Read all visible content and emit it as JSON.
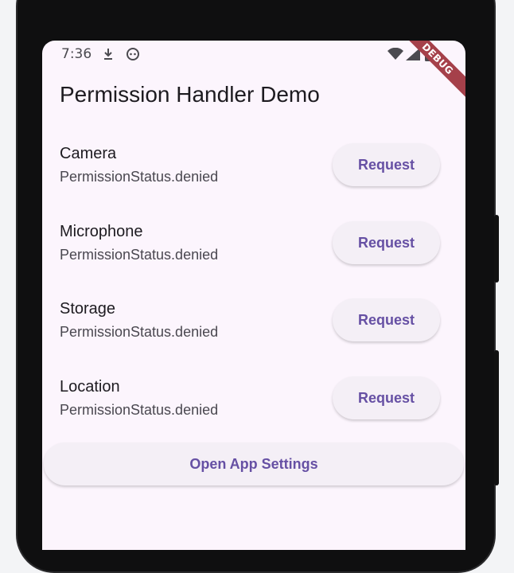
{
  "status_bar": {
    "time": "7:36",
    "left_icons": [
      "download-icon",
      "app-notification-icon"
    ],
    "right_icons": [
      "wifi-icon",
      "signal-icon",
      "battery-icon"
    ]
  },
  "debug_banner": "DEBUG",
  "app_bar": {
    "title": "Permission Handler Demo"
  },
  "permissions": [
    {
      "name": "Camera",
      "status": "PermissionStatus.denied",
      "button": "Request"
    },
    {
      "name": "Microphone",
      "status": "PermissionStatus.denied",
      "button": "Request"
    },
    {
      "name": "Storage",
      "status": "PermissionStatus.denied",
      "button": "Request"
    },
    {
      "name": "Location",
      "status": "PermissionStatus.denied",
      "button": "Request"
    }
  ],
  "settings_button": {
    "label": "Open App Settings"
  },
  "colors": {
    "background": "#fcf5fd",
    "button_bg": "#f4eff6",
    "accent": "#6650a4",
    "debug_banner": "#a5404a"
  }
}
